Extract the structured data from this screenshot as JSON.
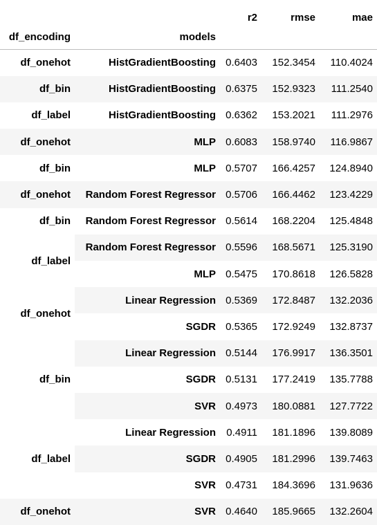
{
  "header": {
    "metrics": [
      "r2",
      "rmse",
      "mae"
    ],
    "index_names": [
      "df_encoding",
      "models"
    ]
  },
  "rows": [
    {
      "encoding": "df_onehot",
      "model": "HistGradientBoosting",
      "r2": "0.6403",
      "rmse": "152.3454",
      "mae": "110.4024"
    },
    {
      "encoding": "df_bin",
      "model": "HistGradientBoosting",
      "r2": "0.6375",
      "rmse": "152.9323",
      "mae": "111.2540"
    },
    {
      "encoding": "df_label",
      "model": "HistGradientBoosting",
      "r2": "0.6362",
      "rmse": "153.2021",
      "mae": "111.2976"
    },
    {
      "encoding": "df_onehot",
      "model": "MLP",
      "r2": "0.6083",
      "rmse": "158.9740",
      "mae": "116.9867"
    },
    {
      "encoding": "df_bin",
      "model": "MLP",
      "r2": "0.5707",
      "rmse": "166.4257",
      "mae": "124.8940"
    },
    {
      "encoding": "df_onehot",
      "model": "Random Forest Regressor",
      "r2": "0.5706",
      "rmse": "166.4462",
      "mae": "123.4229"
    },
    {
      "encoding": "df_bin",
      "model": "Random Forest Regressor",
      "r2": "0.5614",
      "rmse": "168.2204",
      "mae": "125.4848"
    },
    {
      "encoding": "df_label",
      "model": "Random Forest Regressor",
      "r2": "0.5596",
      "rmse": "168.5671",
      "mae": "125.3190"
    },
    {
      "encoding": "",
      "model": "MLP",
      "r2": "0.5475",
      "rmse": "170.8618",
      "mae": "126.5828"
    },
    {
      "encoding": "df_onehot",
      "model": "Linear Regression",
      "r2": "0.5369",
      "rmse": "172.8487",
      "mae": "132.2036"
    },
    {
      "encoding": "",
      "model": "SGDR",
      "r2": "0.5365",
      "rmse": "172.9249",
      "mae": "132.8737"
    },
    {
      "encoding": "df_bin",
      "model": "Linear Regression",
      "r2": "0.5144",
      "rmse": "176.9917",
      "mae": "136.3501"
    },
    {
      "encoding": "",
      "model": "SGDR",
      "r2": "0.5131",
      "rmse": "177.2419",
      "mae": "135.7788"
    },
    {
      "encoding": "",
      "model": "SVR",
      "r2": "0.4973",
      "rmse": "180.0881",
      "mae": "127.7722"
    },
    {
      "encoding": "df_label",
      "model": "Linear Regression",
      "r2": "0.4911",
      "rmse": "181.1896",
      "mae": "139.8089"
    },
    {
      "encoding": "",
      "model": "SGDR",
      "r2": "0.4905",
      "rmse": "181.2996",
      "mae": "139.7463"
    },
    {
      "encoding": "",
      "model": "SVR",
      "r2": "0.4731",
      "rmse": "184.3696",
      "mae": "131.9636"
    },
    {
      "encoding": "df_onehot",
      "model": "SVR",
      "r2": "0.4640",
      "rmse": "185.9665",
      "mae": "132.2604"
    }
  ],
  "encoding_spans": [
    1,
    1,
    1,
    1,
    1,
    1,
    1,
    2,
    0,
    2,
    0,
    3,
    0,
    0,
    3,
    0,
    0,
    1
  ]
}
